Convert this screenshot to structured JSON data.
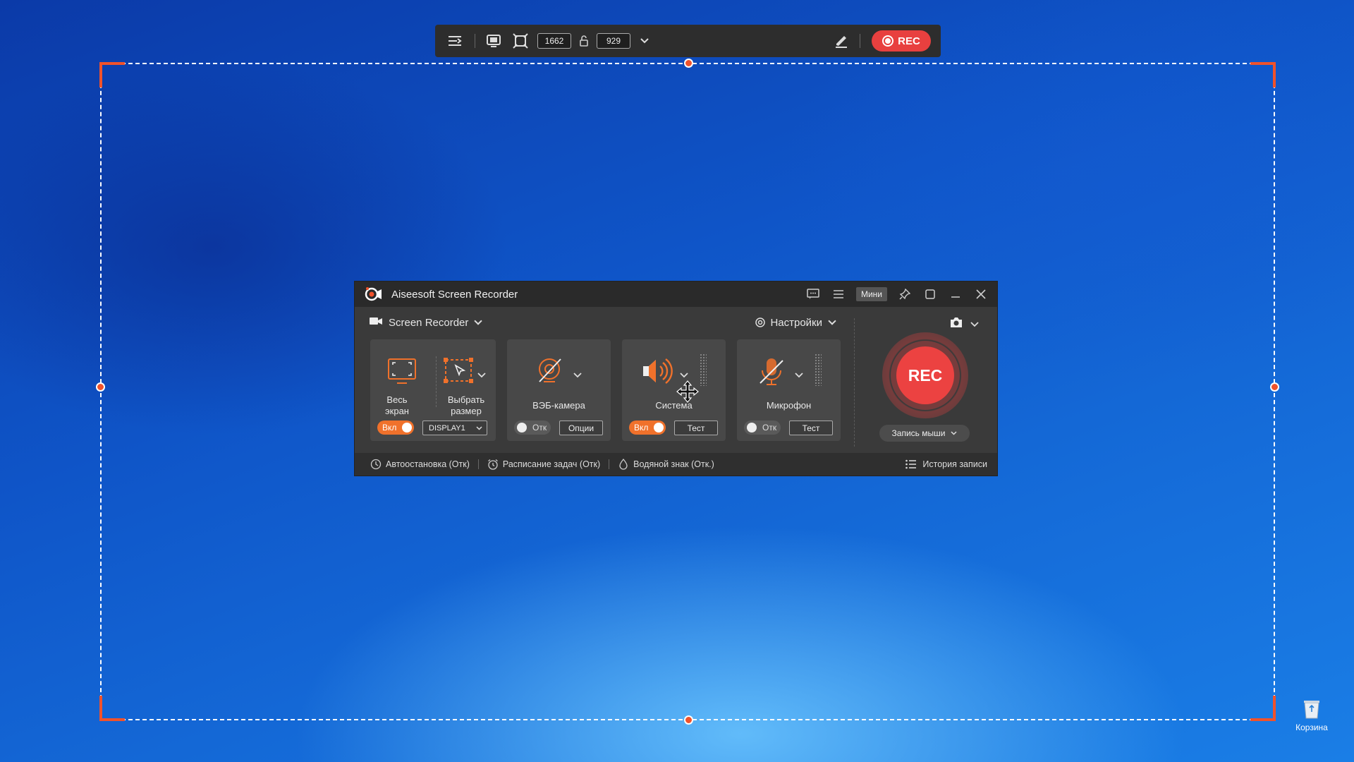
{
  "toolbar": {
    "width_value": "1662",
    "height_value": "929",
    "rec_label": "REC"
  },
  "window": {
    "title": "Aiseesoft Screen Recorder",
    "mini_label": "Мини",
    "mode_label": "Screen Recorder",
    "settings_label": "Настройки"
  },
  "cards": {
    "full_screen_label": "Весь экран",
    "select_size_label": "Выбрать размер",
    "display_toggle": "Вкл",
    "display_select": "DISPLAY1",
    "webcam_label": "ВЭБ-камера",
    "webcam_toggle": "Отк",
    "webcam_options": "Опции",
    "system_label": "Система",
    "system_toggle": "Вкл",
    "system_test": "Тест",
    "mic_label": "Микрофон",
    "mic_toggle": "Отк",
    "mic_test": "Тест"
  },
  "record": {
    "rec_label": "REC",
    "mouse_label": "Запись мыши"
  },
  "statusbar": {
    "auto_stop": "Автоостановка (Отк)",
    "schedule": "Расписание задач (Отк)",
    "watermark": "Водяной знак (Отк.)",
    "history": "История записи"
  },
  "desktop": {
    "recycle_bin_label": "Корзина"
  },
  "colors": {
    "accent": "#f0712b",
    "rec_red": "#ec4241",
    "frame_orange": "#f0522b"
  }
}
